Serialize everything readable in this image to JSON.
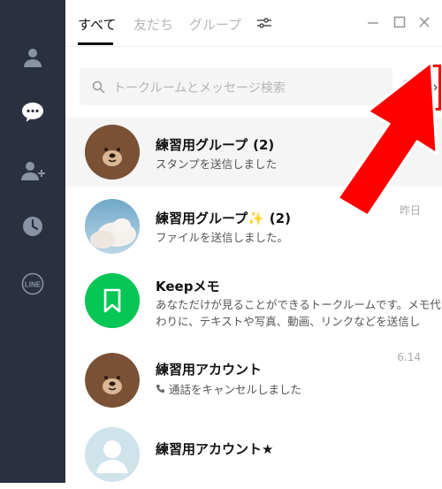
{
  "tabs": [
    {
      "label": "すべて"
    },
    {
      "label": "友だち"
    },
    {
      "label": "グループ"
    }
  ],
  "search": {
    "placeholder": "トークルームとメッセージ検索"
  },
  "chats": [
    {
      "title": "練習用グループ",
      "count": "(2)",
      "subtitle": "スタンプを送信しました",
      "time": ""
    },
    {
      "title": "練習用グループ✨",
      "count": "(2)",
      "subtitle": "ファイルを送信しました。",
      "time": "昨日"
    },
    {
      "title": "Keepメモ",
      "count": "",
      "subtitle_line1": "あなただけが見ることができるトークルームです。メモ代",
      "subtitle_line2": "わりに、テキストや写真、動画、リンクなどを送信し",
      "time": ""
    },
    {
      "title": "練習用アカウント",
      "count": "",
      "subtitle": "通話をキャンセルしました",
      "time": "6.14"
    },
    {
      "title": "練習用アカウント★",
      "count": "",
      "subtitle": "",
      "time": ""
    }
  ],
  "colors": {
    "sidebar": "#2a3040",
    "keep_green": "#06c755",
    "annotation_red": "#ff0000"
  }
}
